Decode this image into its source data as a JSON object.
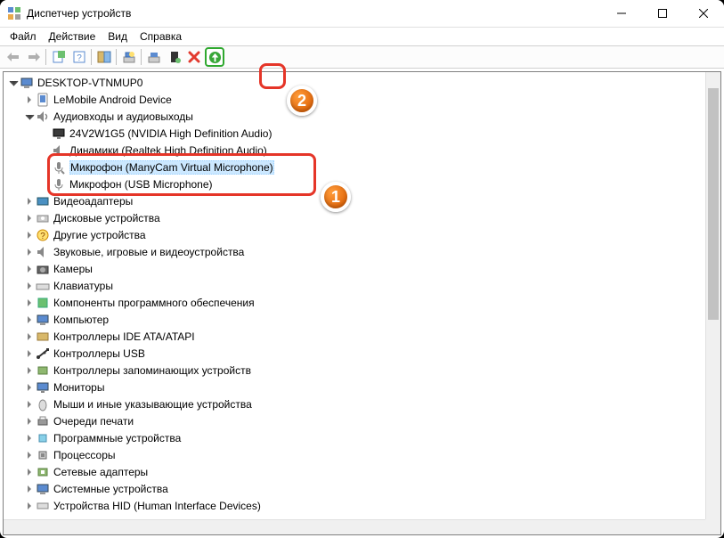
{
  "window": {
    "title": "Диспетчер устройств"
  },
  "menu": {
    "file": "Файл",
    "action": "Действие",
    "view": "Вид",
    "help": "Справка"
  },
  "tree": {
    "root": "DESKTOP-VTNMUP0",
    "lemobile": "LeMobile Android Device",
    "audio": "Аудиовходы и аудиовыходы",
    "audio_child_1": "24V2W1G5 (NVIDIA High Definition Audio)",
    "audio_child_2": "Динамики (Realtek High Definition Audio)",
    "audio_child_3": "Микрофон (ManyCam Virtual Microphone)",
    "audio_child_4": "Микрофон (USB Microphone)",
    "video_adapters": "Видеоадаптеры",
    "disk": "Дисковые устройства",
    "other": "Другие устройства",
    "sound": "Звуковые, игровые и видеоустройства",
    "cameras": "Камеры",
    "keyboards": "Клавиатуры",
    "software_components": "Компоненты программного обеспечения",
    "computer": "Компьютер",
    "ide": "Контроллеры IDE ATA/ATAPI",
    "usb_controllers": "Контроллеры USB",
    "storage_controllers": "Контроллеры запоминающих устройств",
    "monitors": "Мониторы",
    "mice": "Мыши и иные указывающие устройства",
    "print_queues": "Очереди печати",
    "software_devices": "Программные устройства",
    "processors": "Процессоры",
    "network": "Сетевые адаптеры",
    "system": "Системные устройства",
    "hid": "Устройства HID (Human Interface Devices)"
  },
  "annotations": {
    "callout1": "1",
    "callout2": "2"
  }
}
